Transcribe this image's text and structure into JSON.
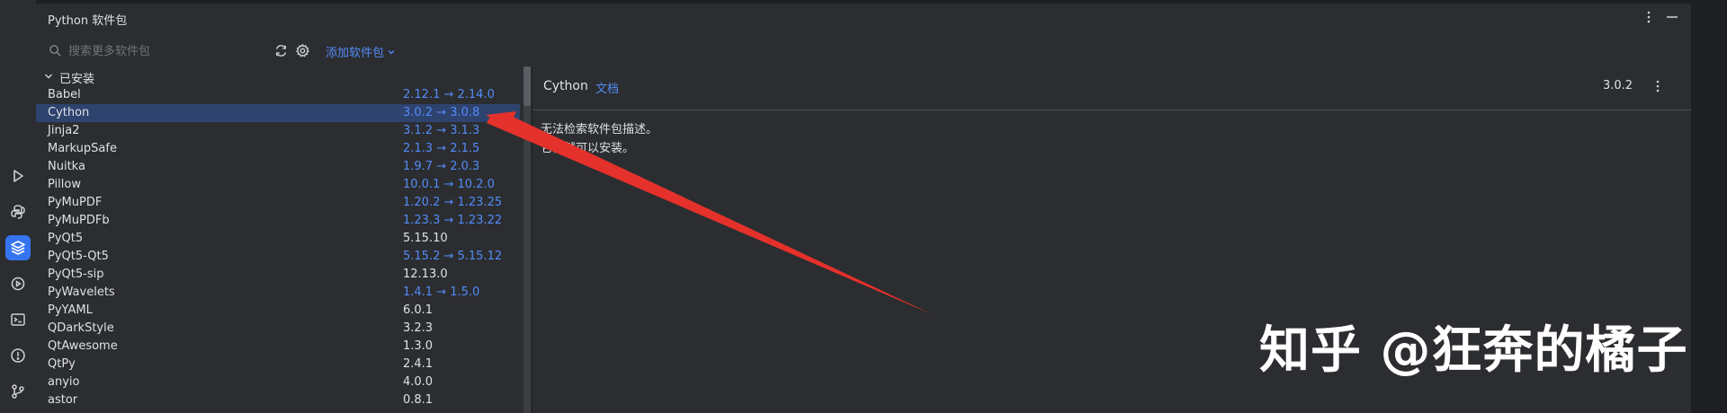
{
  "panel": {
    "title": "Python 软件包",
    "search_placeholder": "搜索更多软件包",
    "add_label": "添加软件包"
  },
  "installed": {
    "section_label": "已安装",
    "packages": [
      {
        "name": "Babel",
        "version": "2.12.1 → 2.14.0",
        "upgrade": true
      },
      {
        "name": "Cython",
        "version": "3.0.2 → 3.0.8",
        "upgrade": true,
        "selected": true
      },
      {
        "name": "Jinja2",
        "version": "3.1.2 → 3.1.3",
        "upgrade": true
      },
      {
        "name": "MarkupSafe",
        "version": "2.1.3 → 2.1.5",
        "upgrade": true
      },
      {
        "name": "Nuitka",
        "version": "1.9.7 → 2.0.3",
        "upgrade": true
      },
      {
        "name": "Pillow",
        "version": "10.0.1 → 10.2.0",
        "upgrade": true
      },
      {
        "name": "PyMuPDF",
        "version": "1.20.2 → 1.23.25",
        "upgrade": true
      },
      {
        "name": "PyMuPDFb",
        "version": "1.23.3 → 1.23.22",
        "upgrade": true
      },
      {
        "name": "PyQt5",
        "version": "5.15.10",
        "upgrade": false
      },
      {
        "name": "PyQt5-Qt5",
        "version": "5.15.2 → 5.15.12",
        "upgrade": true
      },
      {
        "name": "PyQt5-sip",
        "version": "12.13.0",
        "upgrade": false
      },
      {
        "name": "PyWavelets",
        "version": "1.4.1 → 1.5.0",
        "upgrade": true
      },
      {
        "name": "PyYAML",
        "version": "6.0.1",
        "upgrade": false
      },
      {
        "name": "QDarkStyle",
        "version": "3.2.3",
        "upgrade": false
      },
      {
        "name": "QtAwesome",
        "version": "1.3.0",
        "upgrade": false
      },
      {
        "name": "QtPy",
        "version": "2.4.1",
        "upgrade": false
      },
      {
        "name": "anyio",
        "version": "4.0.0",
        "upgrade": false
      },
      {
        "name": "astor",
        "version": "0.8.1",
        "upgrade": false
      }
    ]
  },
  "detail": {
    "name": "Cython",
    "docs_label": "文档",
    "version": "3.0.2",
    "line1": "无法检索软件包描述。",
    "line2": "它仍然可以安装。"
  },
  "watermark": "知乎 @狂奔的橘子",
  "colors": {
    "accent": "#548af7",
    "selected_row": "#2e436e",
    "arrow": "#e5312b"
  },
  "icons": {
    "strip": [
      "run-icon",
      "python-console-icon",
      "python-packages-icon",
      "services-icon",
      "terminal-icon",
      "problems-icon",
      "git-icon"
    ]
  }
}
